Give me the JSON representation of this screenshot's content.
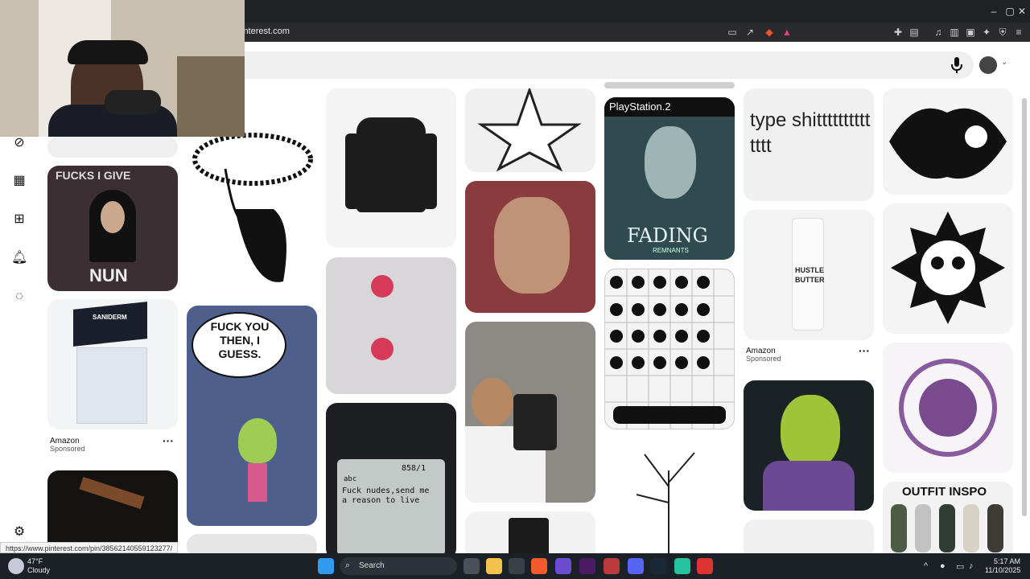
{
  "browser": {
    "url": "interest.com",
    "window_controls": [
      "–",
      "▢",
      "✕"
    ]
  },
  "status_url": "https://www.pinterest.com/pin/38562140559123277/",
  "pins": {
    "amazon_1": {
      "source": "Amazon",
      "sponsored": "Sponsored",
      "more": "···"
    },
    "amazon_2": {
      "source": "Amazon",
      "sponsored": "Sponsored",
      "more": "···"
    },
    "nun": {
      "top": "FUCKS I GIVE",
      "bottom": "NUN"
    },
    "zim": {
      "speech": "FUCK YOU THEN, I GUESS."
    },
    "ps2": {
      "brand": "PlayStation.2",
      "title": "FADING",
      "subtitle": "REMNANTS"
    },
    "phone": {
      "top_right": "858/1",
      "left": "abc",
      "message": "Fuck nudes,send me a reason to live"
    },
    "type": {
      "text": "type shitttttttttttttt"
    },
    "hustle": {
      "line1": "HUSTLE",
      "line2": "BUTTER"
    },
    "outfit": {
      "text": "OUTFIT INSPO"
    },
    "saniderm": {
      "brand": "SANIDERM"
    }
  },
  "taskbar": {
    "weather_temp": "47°F",
    "weather_desc": "Cloudy",
    "search": "Search",
    "time": "5:17 AM",
    "date": "11/10/2025"
  }
}
